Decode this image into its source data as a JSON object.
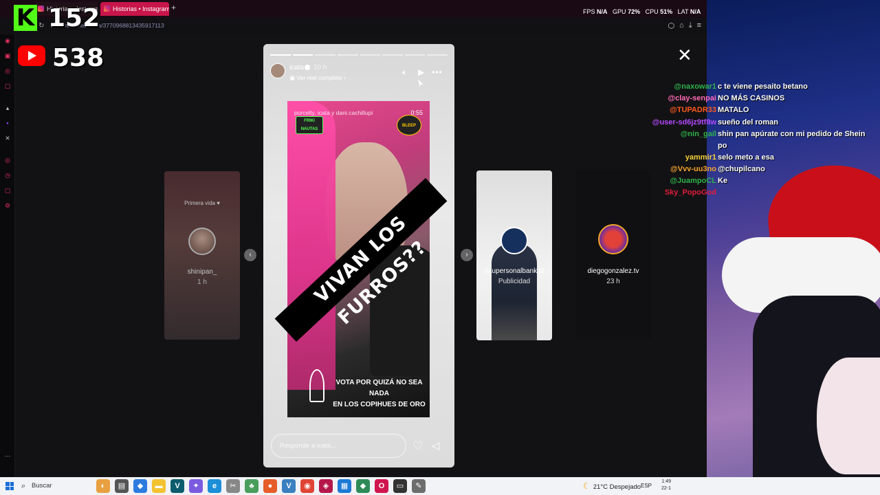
{
  "browser": {
    "tabs": [
      {
        "label": "Historias • Instagram",
        "active": false
      },
      {
        "label": "Historias • Instagram",
        "active": true
      }
    ],
    "new_tab": "+",
    "url": "m.com/stories/icata/3770968813435917113",
    "nav_icons": "‹ ↻",
    "right_icons": [
      "⬡",
      "⌂",
      "⤓",
      "≡"
    ]
  },
  "overlay": {
    "kick_logo": "K",
    "kick_count": "152",
    "youtube_count": "538"
  },
  "story": {
    "username": "icata",
    "time": "10 h",
    "reel_link": "Ver reel completo",
    "video_top_text": "porcelty, icata y dani.cachillupi",
    "duration": "0:55",
    "logo_left": "FRIKI NAUTAS",
    "logo_right": "BLEEP",
    "banner": "VIVAN LOS FURROS??",
    "vote_line1": "VOTA POR QUIZÁ NO SEA NADA",
    "vote_line2": "EN LOS COPIHUES DE ORO",
    "reply_placeholder": "Responde a icata...",
    "progress": {
      "segments": 8,
      "completed": 2
    }
  },
  "side_stories": [
    {
      "name": "shinipan_",
      "sub": "1 h",
      "top_text": "Primera vida ♥"
    },
    {
      "name": "itaupersonalbank.cl",
      "sub": "Publicidad"
    },
    {
      "name": "diegogonzalez.tv",
      "sub": "23 h"
    }
  ],
  "close_label": "✕",
  "perf": {
    "fps_label": "FPS",
    "fps": "N/A",
    "gpu_label": "GPU",
    "gpu": "72%",
    "cpu_label": "CPU",
    "cpu": "51%",
    "lat_label": "LAT",
    "lat": "N/A"
  },
  "chat": [
    {
      "user": "@naxowar1",
      "text": "c te viene pesaito betano",
      "color": "#2fb24a"
    },
    {
      "user": "@clay-senpai",
      "text": "NO MÁS CASINOS",
      "color": "#ff69b4"
    },
    {
      "user": "@TUPADR33",
      "text": "MATALO",
      "color": "#ff5a1e"
    },
    {
      "user": "@user-sd6jz9tf8w",
      "text": "sueño del roman",
      "color": "#b44aff"
    },
    {
      "user": "@nin_gail",
      "text": "shin pan apúrate con mi pedido de Shein",
      "text2": "po",
      "color": "#2fb24a"
    },
    {
      "user": "yammir1",
      "text": "selo meto a esa",
      "color": "#f4d13a"
    },
    {
      "user": "@Vvv-uu3no",
      "text": "@chupilcano",
      "color": "#f4a12a"
    },
    {
      "user": "@JuampoCL",
      "text": "Ke",
      "color": "#2fb24a"
    },
    {
      "user": "Sky_PopoGod",
      "text": "",
      "color": "#e01e3c"
    }
  ],
  "taskbar": {
    "search": "Buscar",
    "weather": "21°C Despejado",
    "lang": "ESP",
    "time": "1:49",
    "date": "22-1"
  }
}
